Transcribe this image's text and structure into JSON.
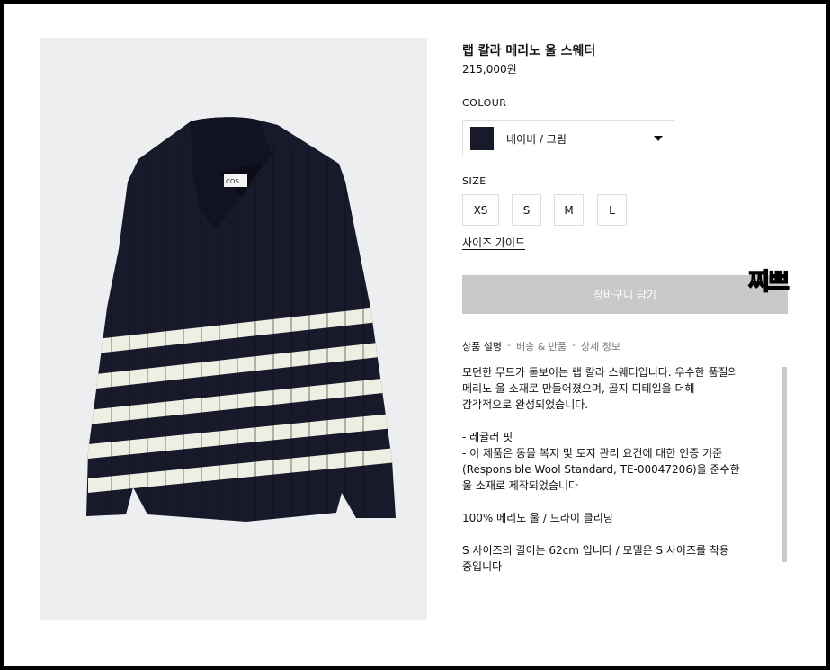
{
  "product": {
    "title": "랩 칼라 메리노 울 스웨터",
    "price": "215,000원",
    "image_label": "COS"
  },
  "colour": {
    "label": "COLOUR",
    "selected": "네이비 / 크림",
    "swatch_color": "#181a2c"
  },
  "size": {
    "label": "SIZE",
    "options": [
      "XS",
      "S",
      "M",
      "L"
    ],
    "guide": "사이즈 가이드"
  },
  "cart": {
    "button_label": "장바구니 담기"
  },
  "tabs": {
    "items": [
      "상품 설명",
      "배송 & 반품",
      "상세 정보"
    ],
    "separator": "-"
  },
  "description": {
    "text": "모던한 무드가 돋보이는 랩 칼라 스웨터입니다. 우수한 품질의\n메리노 울 소재로 만들어졌으며, 골지 디테일을 더해\n감각적으로 완성되었습니다.\n\n- 레귤러 핏\n- 이 제품은 동물 복지 및 토지 관리 요건에 대한 인증 기준\n(Responsible Wool Standard, TE-00047206)을 준수한\n울 소재로 제작되었습니다\n\n100% 메리노 울 / 드라이 클리닝\n\nS 사이즈의 길이는 62cm 입니다 / 모델은 S 사이즈를 착용\n중입니다"
  },
  "sticker": {
    "text": "찌쁘"
  },
  "colors": {
    "navy": "#181a2c",
    "cream": "#efeee3",
    "disabled_button": "#c9c9c9",
    "sticker": "#c8f53a"
  }
}
